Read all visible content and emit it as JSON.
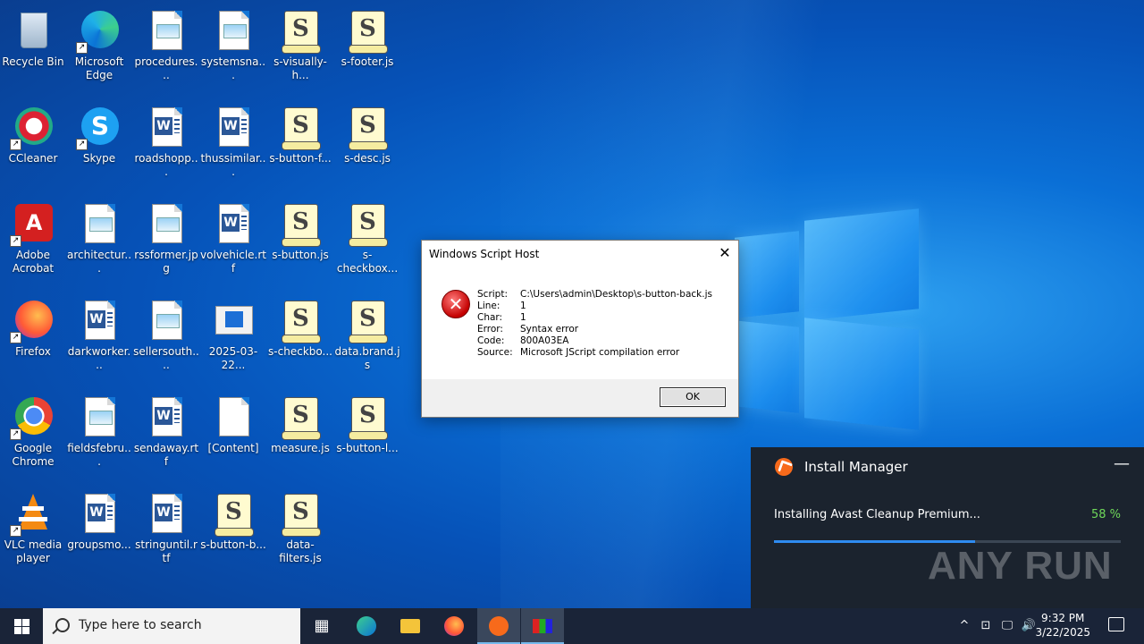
{
  "desktop": {
    "icons": [
      {
        "label": "Recycle Bin"
      },
      {
        "label": "Microsoft Edge"
      },
      {
        "label": "procedures..."
      },
      {
        "label": "systemsna..."
      },
      {
        "label": "s-visually-h..."
      },
      {
        "label": "s-footer.js"
      },
      {
        "label": "CCleaner"
      },
      {
        "label": "Skype"
      },
      {
        "label": "roadshopp..."
      },
      {
        "label": "thussimilar..."
      },
      {
        "label": "s-button-f..."
      },
      {
        "label": "s-desc.js"
      },
      {
        "label": "Adobe Acrobat"
      },
      {
        "label": "architectur..."
      },
      {
        "label": "rssformer.jpg"
      },
      {
        "label": "volvehicle.rtf"
      },
      {
        "label": "s-button.js"
      },
      {
        "label": "s-checkbox..."
      },
      {
        "label": "Firefox"
      },
      {
        "label": "darkworker..."
      },
      {
        "label": "sellersouth...."
      },
      {
        "label": "2025-03-22..."
      },
      {
        "label": "s-checkbo..."
      },
      {
        "label": "data.brand.js"
      },
      {
        "label": "Google Chrome"
      },
      {
        "label": "fieldsfebru..."
      },
      {
        "label": "sendaway.rtf"
      },
      {
        "label": "[Content]"
      },
      {
        "label": "measure.js"
      },
      {
        "label": "s-button-l..."
      },
      {
        "label": "VLC media player"
      },
      {
        "label": "groupsmo..."
      },
      {
        "label": "stringuntil.rtf"
      },
      {
        "label": "s-button-b..."
      },
      {
        "label": "data-filters.js"
      }
    ]
  },
  "dialog": {
    "title": "Windows Script Host",
    "close": "✕",
    "rows": [
      {
        "key": "Script:",
        "value": "C:\\Users\\admin\\Desktop\\s-button-back.js"
      },
      {
        "key": "Line:",
        "value": "1"
      },
      {
        "key": "Char:",
        "value": "1"
      },
      {
        "key": "Error:",
        "value": "Syntax error"
      },
      {
        "key": "Code:",
        "value": "800A03EA"
      },
      {
        "key": "Source:",
        "value": "Microsoft JScript compilation error"
      }
    ],
    "ok_label": "OK"
  },
  "install_manager": {
    "title": "Install Manager",
    "minimize": "—",
    "status": "Installing Avast Cleanup Premium...",
    "percent_text": "58 %",
    "progress": 0.58,
    "watermark": "ANY RUN"
  },
  "taskbar": {
    "search_placeholder": "Type here to search",
    "time": "9:32 PM",
    "date": "3/22/2025"
  },
  "colors": {
    "accent": "#2e8bf0",
    "percent": "#6fd85a",
    "avast": "#f76a1b"
  }
}
